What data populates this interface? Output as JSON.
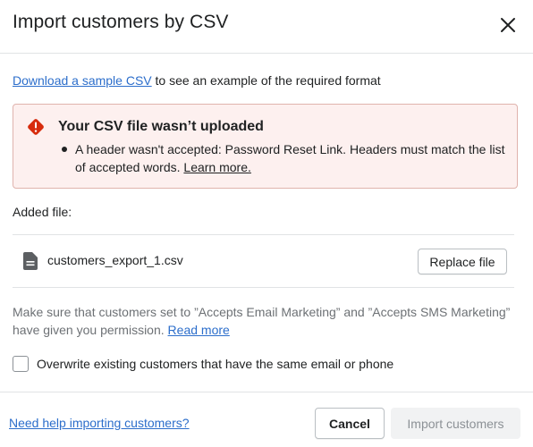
{
  "modal": {
    "title": "Import customers by CSV",
    "close_icon": "close-icon"
  },
  "sample": {
    "link_text": "Download a sample CSV",
    "suffix": " to see an example of the required format"
  },
  "error_banner": {
    "icon": "alert-diamond-icon",
    "title": "Your CSV file wasn’t uploaded",
    "message": "A header wasn't accepted: Password Reset Link. Headers must match the list of accepted words. ",
    "learn_more": "Learn more."
  },
  "added_file": {
    "label": "Added file:",
    "file_icon": "file-icon",
    "file_name": "customers_export_1.csv",
    "replace_label": "Replace file"
  },
  "permission": {
    "text": "Make sure that customers set to ”Accepts Email Marketing” and ”Accepts SMS Marketing” have given you permission. ",
    "read_more": "Read more"
  },
  "overwrite": {
    "label": "Overwrite existing customers that have the same email or phone",
    "checked": false
  },
  "footer": {
    "help_link": "Need help importing customers?",
    "cancel_label": "Cancel",
    "import_label": "Import customers"
  },
  "colors": {
    "link": "#2c6ecb",
    "critical": "#d72c0d",
    "banner_bg": "#fdf0ef",
    "banner_border": "#e0b3ad",
    "disabled_bg": "#f1f2f3",
    "disabled_text": "#8c9196"
  }
}
